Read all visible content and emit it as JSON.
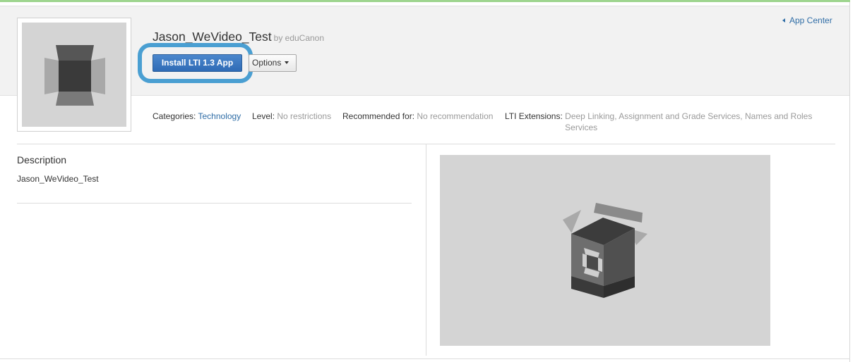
{
  "app": {
    "name": "Jason_WeVideo_Test",
    "publisher": "by eduCanon",
    "thumbnail_icon": "app-box-icon"
  },
  "nav": {
    "app_center_label": "App Center"
  },
  "actions": {
    "install_label": "Install LTI 1.3 App",
    "options_label": "Options"
  },
  "meta": {
    "categories_label": "Categories:",
    "categories_value": "Technology",
    "level_label": "Level:",
    "level_value": "No restrictions",
    "recommended_label": "Recommended for:",
    "recommended_value": "No recommendation",
    "lti_label": "LTI Extensions:",
    "lti_value": "Deep Linking, Assignment and Grade Services, Names and Roles Services"
  },
  "description": {
    "heading": "Description",
    "text": "Jason_WeVideo_Test"
  },
  "screenshot": {
    "icon": "open-box-icon"
  },
  "colors": {
    "install_button": "#3a77c0",
    "highlight_ring": "#4a9fd2",
    "link": "#2f6da6",
    "muted_text": "#9a9a9a"
  }
}
